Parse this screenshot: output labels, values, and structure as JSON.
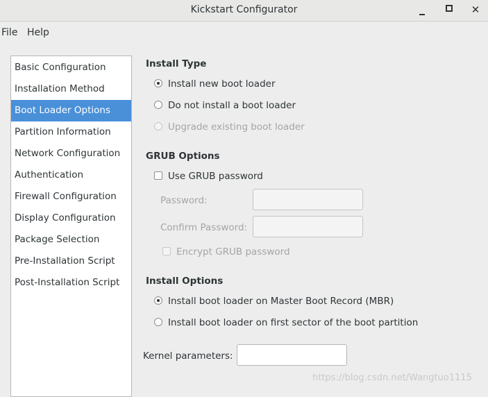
{
  "window": {
    "title": "Kickstart Configurator",
    "minimize_icon": "minimize-icon",
    "maximize_icon": "maximize-icon",
    "close_icon": "close-icon",
    "close_glyph": "✕"
  },
  "menubar": {
    "file": "File",
    "help": "Help"
  },
  "sidebar": {
    "selected_color": "#4a90d9",
    "items": [
      {
        "label": "Basic Configuration"
      },
      {
        "label": "Installation Method"
      },
      {
        "label": "Boot Loader Options",
        "selected": true
      },
      {
        "label": "Partition Information"
      },
      {
        "label": "Network Configuration"
      },
      {
        "label": "Authentication"
      },
      {
        "label": "Firewall Configuration"
      },
      {
        "label": "Display Configuration"
      },
      {
        "label": "Package Selection"
      },
      {
        "label": "Pre-Installation Script"
      },
      {
        "label": "Post-Installation Script"
      }
    ]
  },
  "install_type": {
    "title": "Install Type",
    "options": [
      {
        "label": "Install new boot loader",
        "selected": true,
        "enabled": true
      },
      {
        "label": "Do not install a boot loader",
        "selected": false,
        "enabled": true
      },
      {
        "label": "Upgrade existing boot loader",
        "selected": false,
        "enabled": false
      }
    ]
  },
  "grub_options": {
    "title": "GRUB Options",
    "use_password": {
      "label": "Use GRUB password",
      "checked": false
    },
    "password_label": "Password:",
    "password_value": "",
    "confirm_label": "Confirm Password:",
    "confirm_value": "",
    "encrypt": {
      "label": "Encrypt GRUB password",
      "checked": false,
      "enabled": false
    }
  },
  "install_options": {
    "title": "Install Options",
    "options": [
      {
        "label": "Install boot loader on Master Boot Record (MBR)",
        "selected": true
      },
      {
        "label": "Install boot loader on first sector of the boot partition",
        "selected": false
      }
    ]
  },
  "kernel": {
    "label": "Kernel parameters:",
    "value": ""
  },
  "watermark": "https://blog.csdn.net/Wangtuo1115"
}
